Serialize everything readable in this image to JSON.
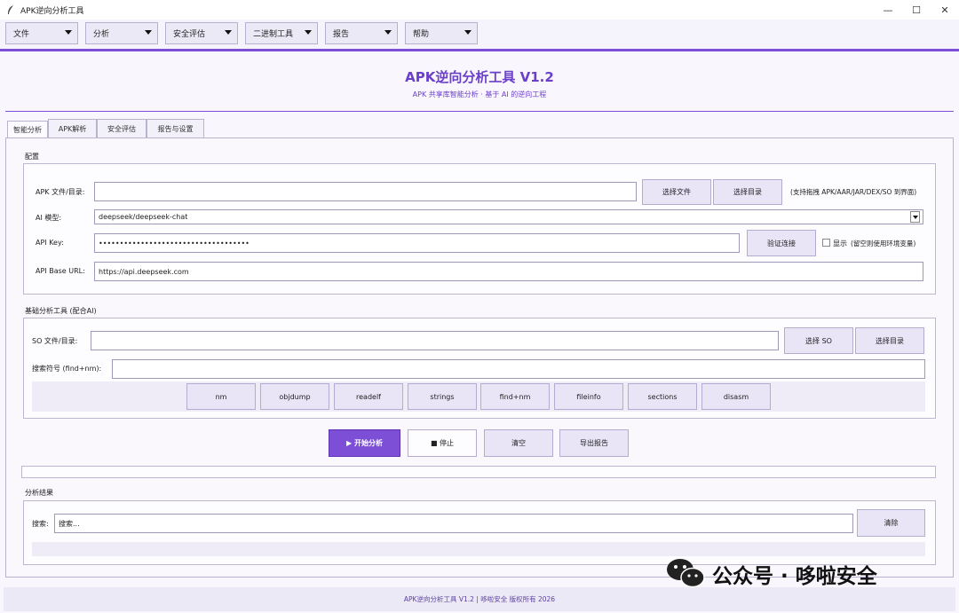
{
  "window": {
    "title": "APK逆向分析工具"
  },
  "menus": [
    "文件",
    "分析",
    "安全评估",
    "二进制工具",
    "报告",
    "帮助"
  ],
  "header": {
    "title": "APK逆向分析工具 V1.2",
    "subtitle": "APK 共享库智能分析 · 基于 AI 的逆向工程"
  },
  "tabs": [
    "智能分析",
    "APK解析",
    "安全评估",
    "报告与设置"
  ],
  "config": {
    "group_label": "配置",
    "apk_label": "APK 文件/目录:",
    "apk_value": "",
    "select_file": "选择文件",
    "select_dir": "选择目录",
    "drag_hint": "(支持拖拽 APK/AAR/JAR/DEX/SO 到界面)",
    "model_label": "AI 模型:",
    "model_value": "deepseek/deepseek-chat",
    "key_label": "API Key:",
    "key_value": "••••••••••••••••••••••••••••••••••••",
    "verify": "验证连接",
    "show": "显示",
    "env_hint": "(留空则使用环境变量)",
    "base_label": "API Base URL:",
    "base_value": "https://api.deepseek.com"
  },
  "tools": {
    "group_label": "基础分析工具 (配合AI)",
    "so_label": "SO 文件/目录:",
    "so_value": "",
    "select_so": "选择 SO",
    "select_dir": "选择目录",
    "symbol_label": "搜索符号 (find+nm):",
    "symbol_value": "",
    "buttons": [
      "nm",
      "objdump",
      "readelf",
      "strings",
      "find+nm",
      "fileinfo",
      "sections",
      "disasm"
    ]
  },
  "actions": {
    "start": "▶ 开始分析",
    "stop": "■ 停止",
    "clear": "清空",
    "export": "导出报告"
  },
  "results": {
    "group_label": "分析结果",
    "search_label": "搜索:",
    "search_placeholder": "搜索...",
    "clear": "清除"
  },
  "footer": "APK逆向分析工具 V1.2 | 哆啦安全 版权所有 2026",
  "watermark": "公众号 · 哆啦安全",
  "colors": {
    "accent": "#7d4fd6",
    "background": "#f9f7fd",
    "button": "#e9e5f7"
  }
}
